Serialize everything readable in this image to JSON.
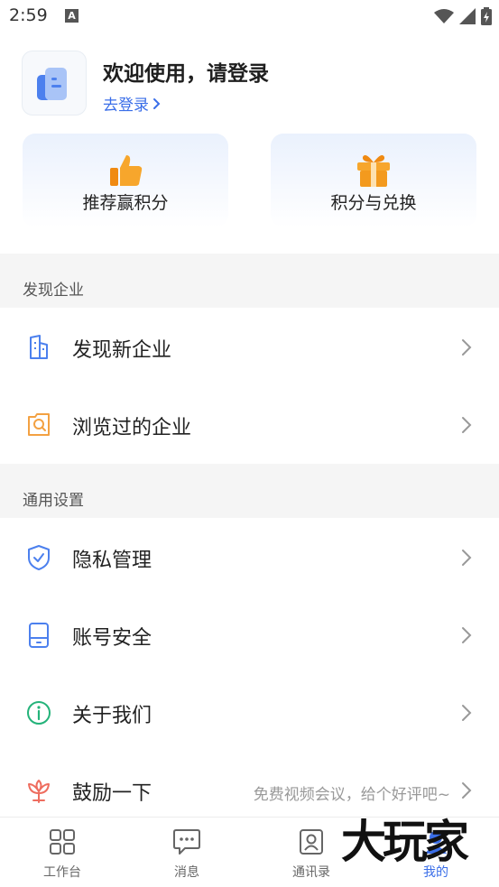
{
  "status_bar": {
    "time": "2:59",
    "notification_glyph": "A"
  },
  "profile": {
    "welcome": "欢迎使用，请登录",
    "login_link": "去登录"
  },
  "cards": [
    {
      "label": "推荐赢积分",
      "icon": "thumbs-up-icon"
    },
    {
      "label": "积分与兑换",
      "icon": "gift-icon"
    }
  ],
  "sections": [
    {
      "title": "发现企业",
      "items": [
        {
          "label": "发现新企业",
          "icon": "building-icon"
        },
        {
          "label": "浏览过的企业",
          "icon": "search-history-icon"
        }
      ]
    },
    {
      "title": "通用设置",
      "items": [
        {
          "label": "隐私管理",
          "icon": "shield-check-icon"
        },
        {
          "label": "账号安全",
          "icon": "phone-icon"
        },
        {
          "label": "关于我们",
          "icon": "info-icon"
        },
        {
          "label": "鼓励一下",
          "icon": "flower-icon",
          "hint": "免费视频会议，给个好评吧~"
        }
      ]
    }
  ],
  "tabbar": [
    {
      "label": "工作台",
      "icon": "grid-icon"
    },
    {
      "label": "消息",
      "icon": "chat-icon"
    },
    {
      "label": "通讯录",
      "icon": "contacts-icon"
    },
    {
      "label": "我的",
      "icon": "profile-icon",
      "active": true
    }
  ],
  "watermark": "大玩家",
  "colors": {
    "accent": "#3a6ee8",
    "section_bg": "#f5f5f5",
    "card_orange": "#f39a1e"
  }
}
